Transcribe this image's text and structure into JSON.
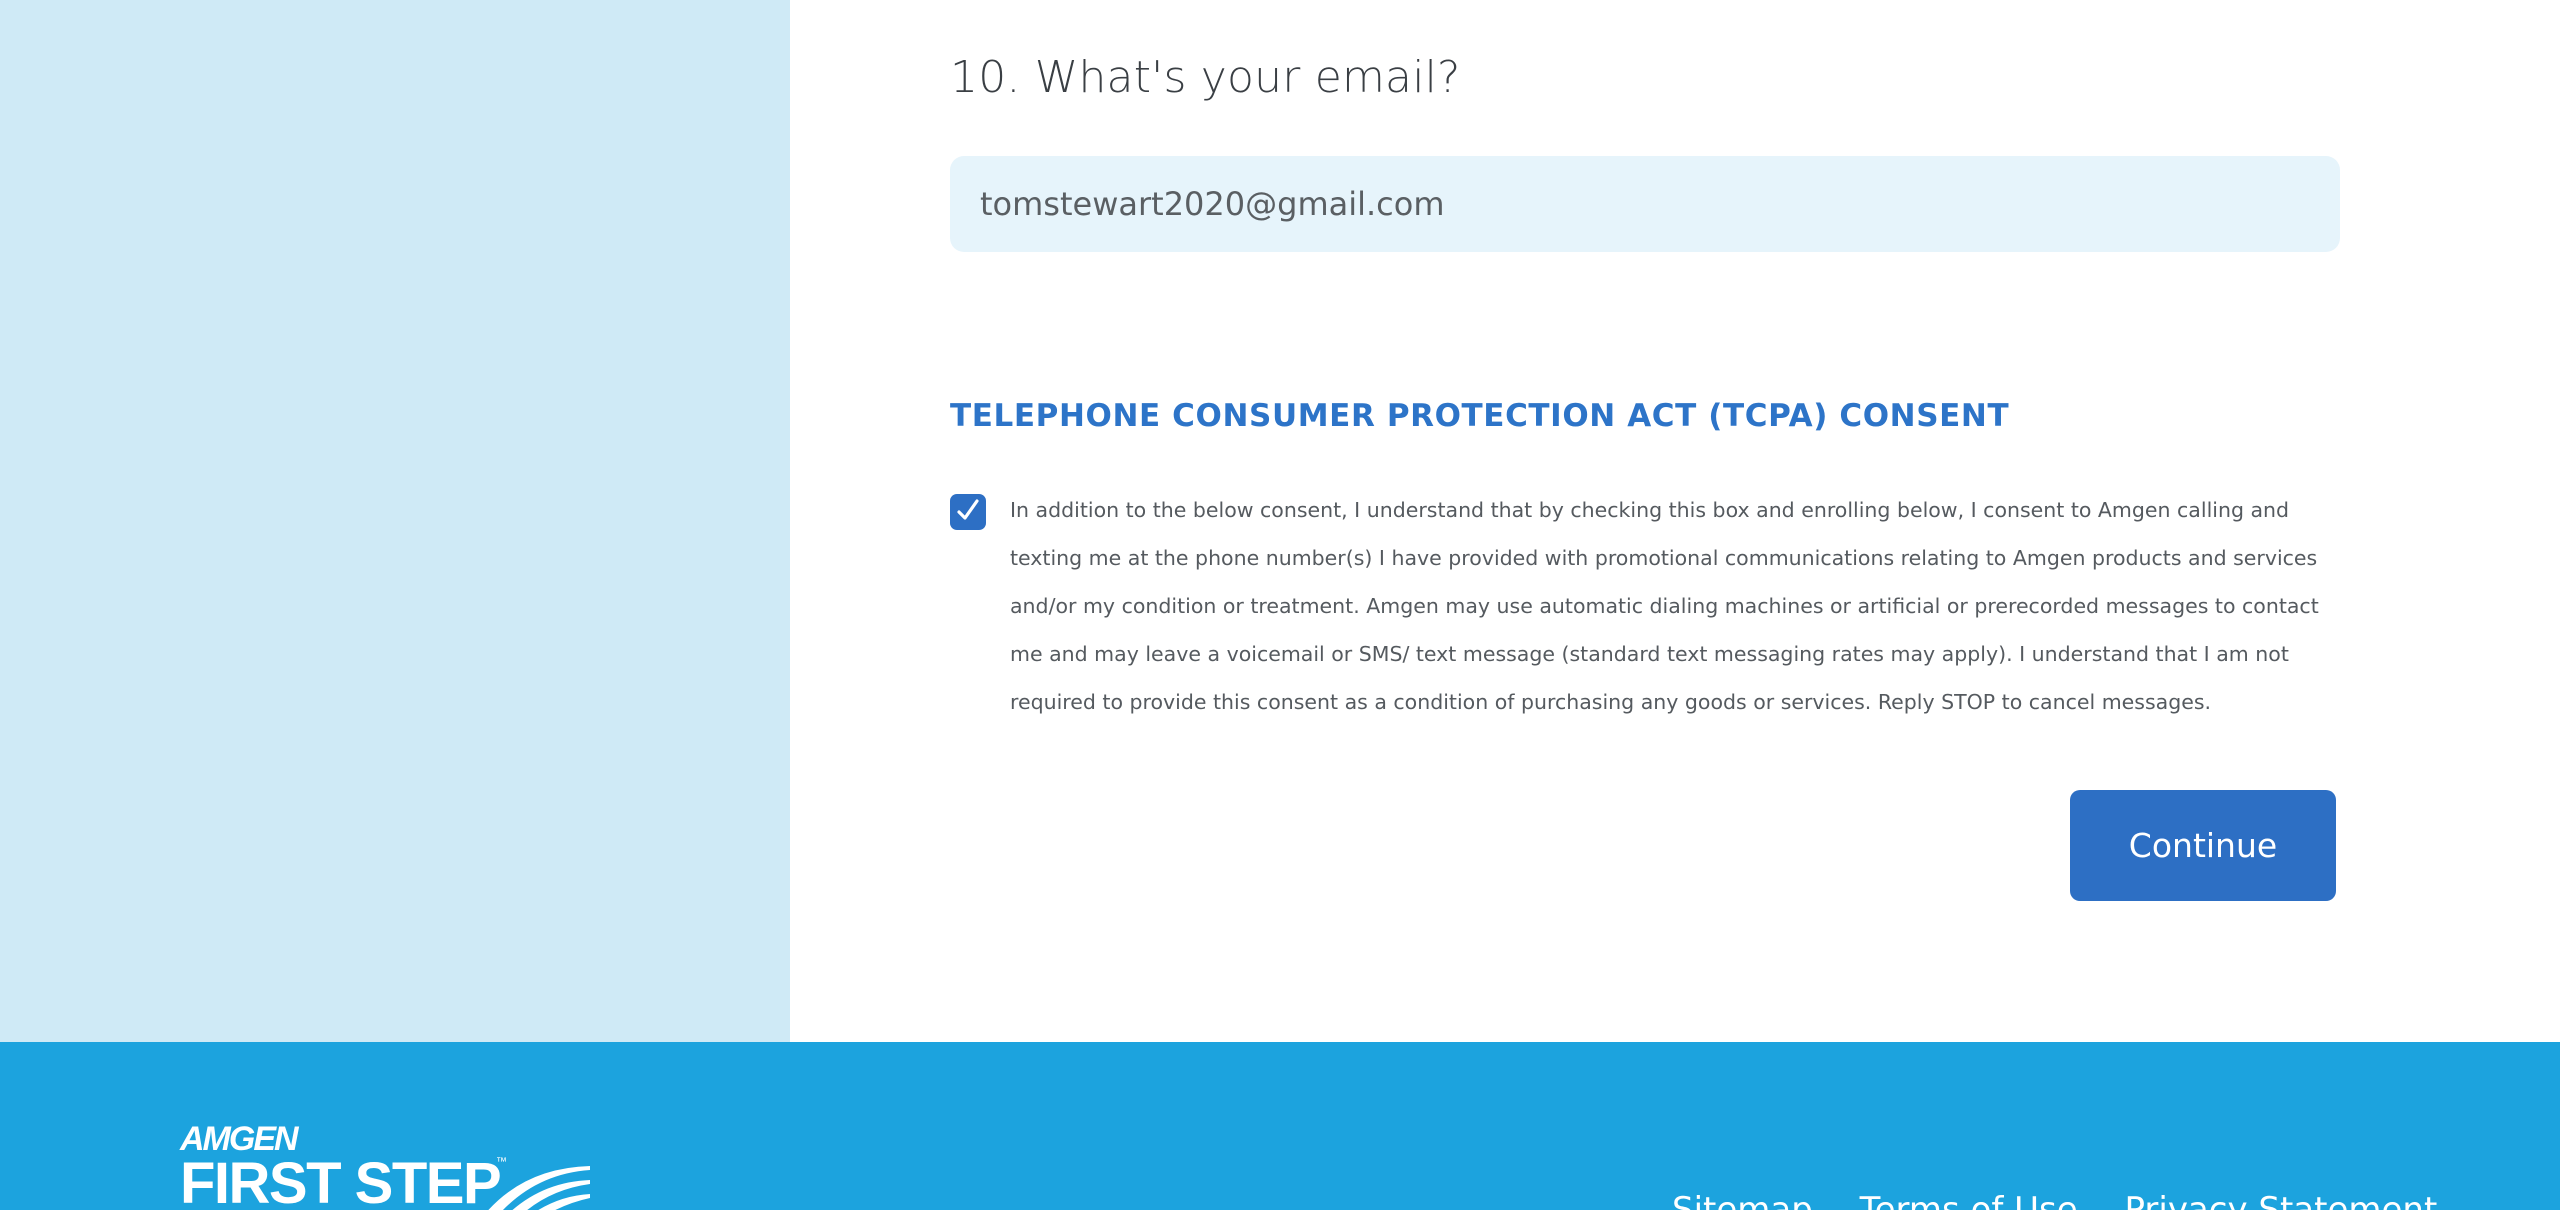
{
  "form": {
    "question": "10. What's your email?",
    "email_value": "tomstewart2020@gmail.com",
    "tcpa_heading": "TELEPHONE CONSUMER PROTECTION ACT (TCPA) CONSENT",
    "consent_checked": true,
    "consent_text": "In addition to the below consent, I understand that by checking this box and enrolling below, I consent to Amgen calling and texting me at the phone number(s) I have provided with promotional communications relating to Amgen products and services and/or my condition or treatment. Amgen may use automatic dialing machines or artificial or prerecorded messages to contact me and may leave a voicemail or SMS/ text message (standard text messaging rates may apply). I understand that I am not required to provide this consent as a condition of purchasing any goods or services. Reply STOP to cancel messages.",
    "continue_label": "Continue"
  },
  "footer": {
    "logo_top": "AMGEN",
    "logo_main": "FIRST STEP",
    "logo_tm": "™",
    "links": {
      "sitemap": "Sitemap",
      "terms": "Terms of Use",
      "privacy": "Privacy Statement"
    }
  },
  "colors": {
    "left_panel": "#cfeaf6",
    "input_bg": "#e6f4fb",
    "accent_blue": "#2d6fc4",
    "heading_blue": "#2d74c8",
    "footer_bg": "#1ca3de"
  },
  "icons": {
    "checkbox": "check-icon",
    "logo_mark": "swoosh-icon"
  }
}
